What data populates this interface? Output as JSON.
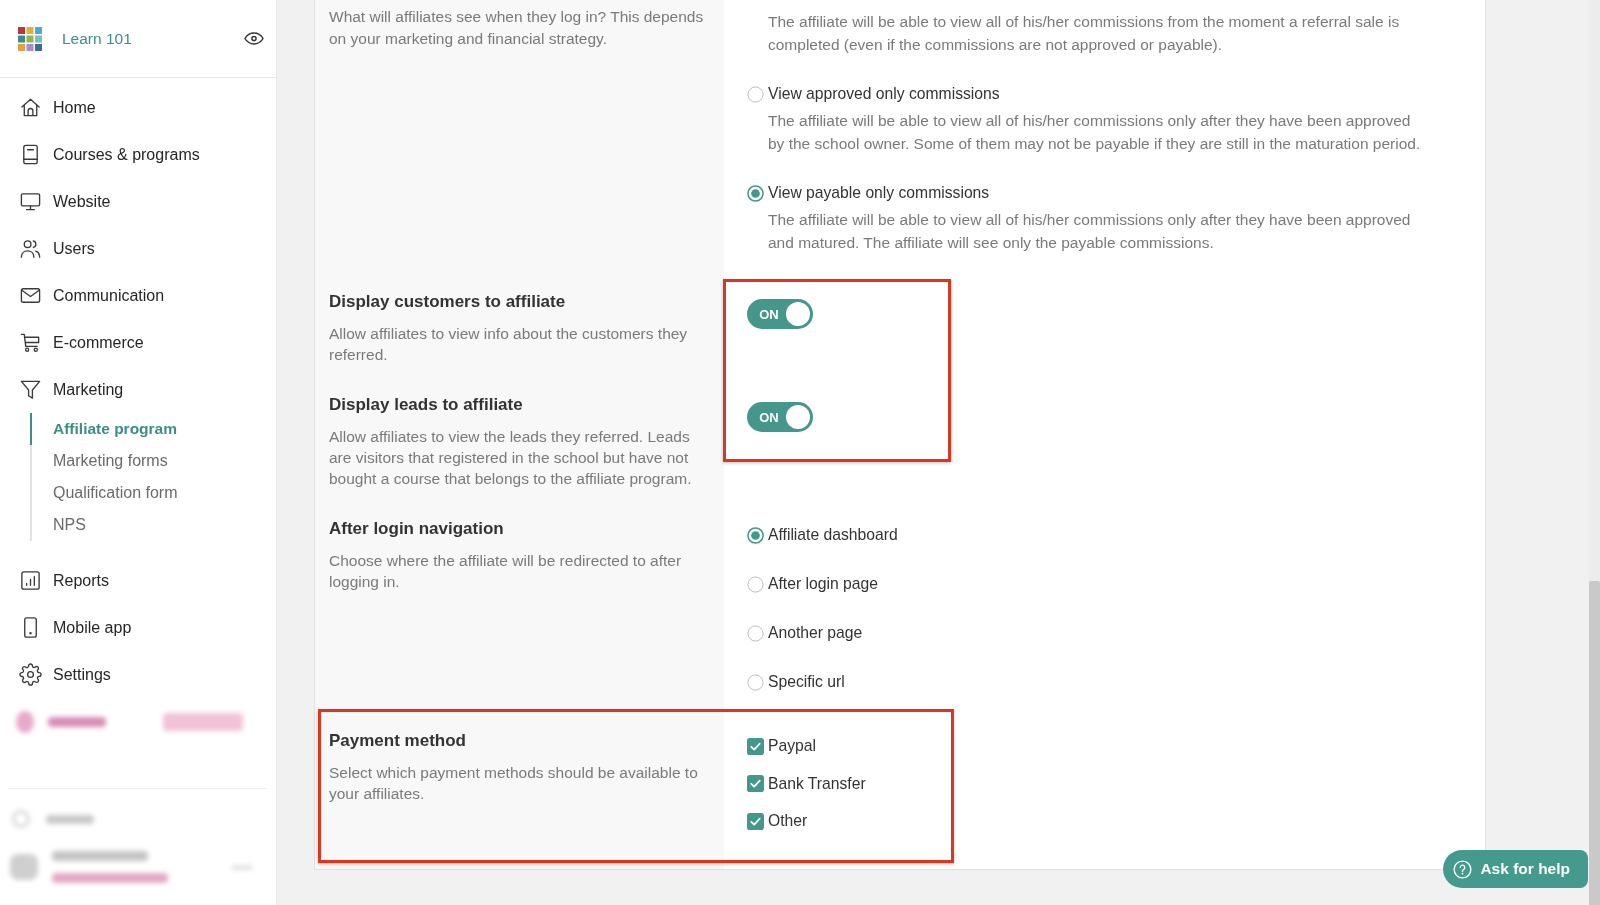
{
  "sidebar": {
    "brand": "Learn 101",
    "nav": [
      {
        "label": "Home",
        "selected": false
      },
      {
        "label": "Courses & programs",
        "selected": false
      },
      {
        "label": "Website",
        "selected": false
      },
      {
        "label": "Users",
        "selected": false
      },
      {
        "label": "Communication",
        "selected": false
      },
      {
        "label": "E-commerce",
        "selected": false
      },
      {
        "label": "Marketing",
        "selected": false,
        "children": [
          {
            "label": "Affiliate program",
            "selected": true
          },
          {
            "label": "Marketing forms",
            "selected": false
          },
          {
            "label": "Qualification form",
            "selected": false
          },
          {
            "label": "NPS",
            "selected": false
          }
        ]
      },
      {
        "label": "Reports",
        "selected": false
      },
      {
        "label": "Mobile app",
        "selected": false
      },
      {
        "label": "Settings",
        "selected": false
      }
    ]
  },
  "settings": [
    {
      "kind": "radio_group",
      "description": "What will affiliates see when they log in? This depends on your marketing and financial strategy.",
      "highlighted": false,
      "options": [
        {
          "description": "The affiliate will be able to view all of his/her commissions from the moment a referral sale is completed (even if the commissions are not approved or payable)."
        },
        {
          "label": "View approved only commissions",
          "description": "The affiliate will be able to view all of his/her commissions only after they have been approved by the school owner. Some of them may not be payable if they are still in the maturation period.",
          "selected": false
        },
        {
          "label": "View payable only commissions",
          "description": "The affiliate will be able to view all of his/her commissions only after they have been approved and matured. The affiliate will see only the payable commissions.",
          "selected": true
        }
      ]
    },
    {
      "kind": "toggle",
      "title": "Display customers to affiliate",
      "description": "Allow affiliates to view info about the customers they referred.",
      "on": true,
      "state_text": "ON",
      "highlighted": true
    },
    {
      "kind": "toggle",
      "title": "Display leads to affiliate",
      "description": "Allow affiliates to view the leads they referred. Leads are visitors that registered in the school but have not bought a course that belongs to the affiliate program.",
      "on": true,
      "state_text": "ON",
      "highlighted": true
    },
    {
      "kind": "radio_group",
      "title": "After login navigation",
      "description": "Choose where the affiliate will be redirected to after logging in.",
      "highlighted": false,
      "options": [
        {
          "label": "Affiliate dashboard",
          "selected": true
        },
        {
          "label": "After login page",
          "selected": false
        },
        {
          "label": "Another page",
          "selected": false
        },
        {
          "label": "Specific url",
          "selected": false
        }
      ]
    },
    {
      "kind": "checkbox_group",
      "title": "Payment method",
      "description": "Select which payment methods should be available to your affiliates.",
      "highlighted": true,
      "options": [
        {
          "label": "Paypal",
          "checked": true
        },
        {
          "label": "Bank Transfer",
          "checked": true
        },
        {
          "label": "Other",
          "checked": true
        }
      ]
    }
  ],
  "help_button": {
    "label": "Ask for help"
  }
}
